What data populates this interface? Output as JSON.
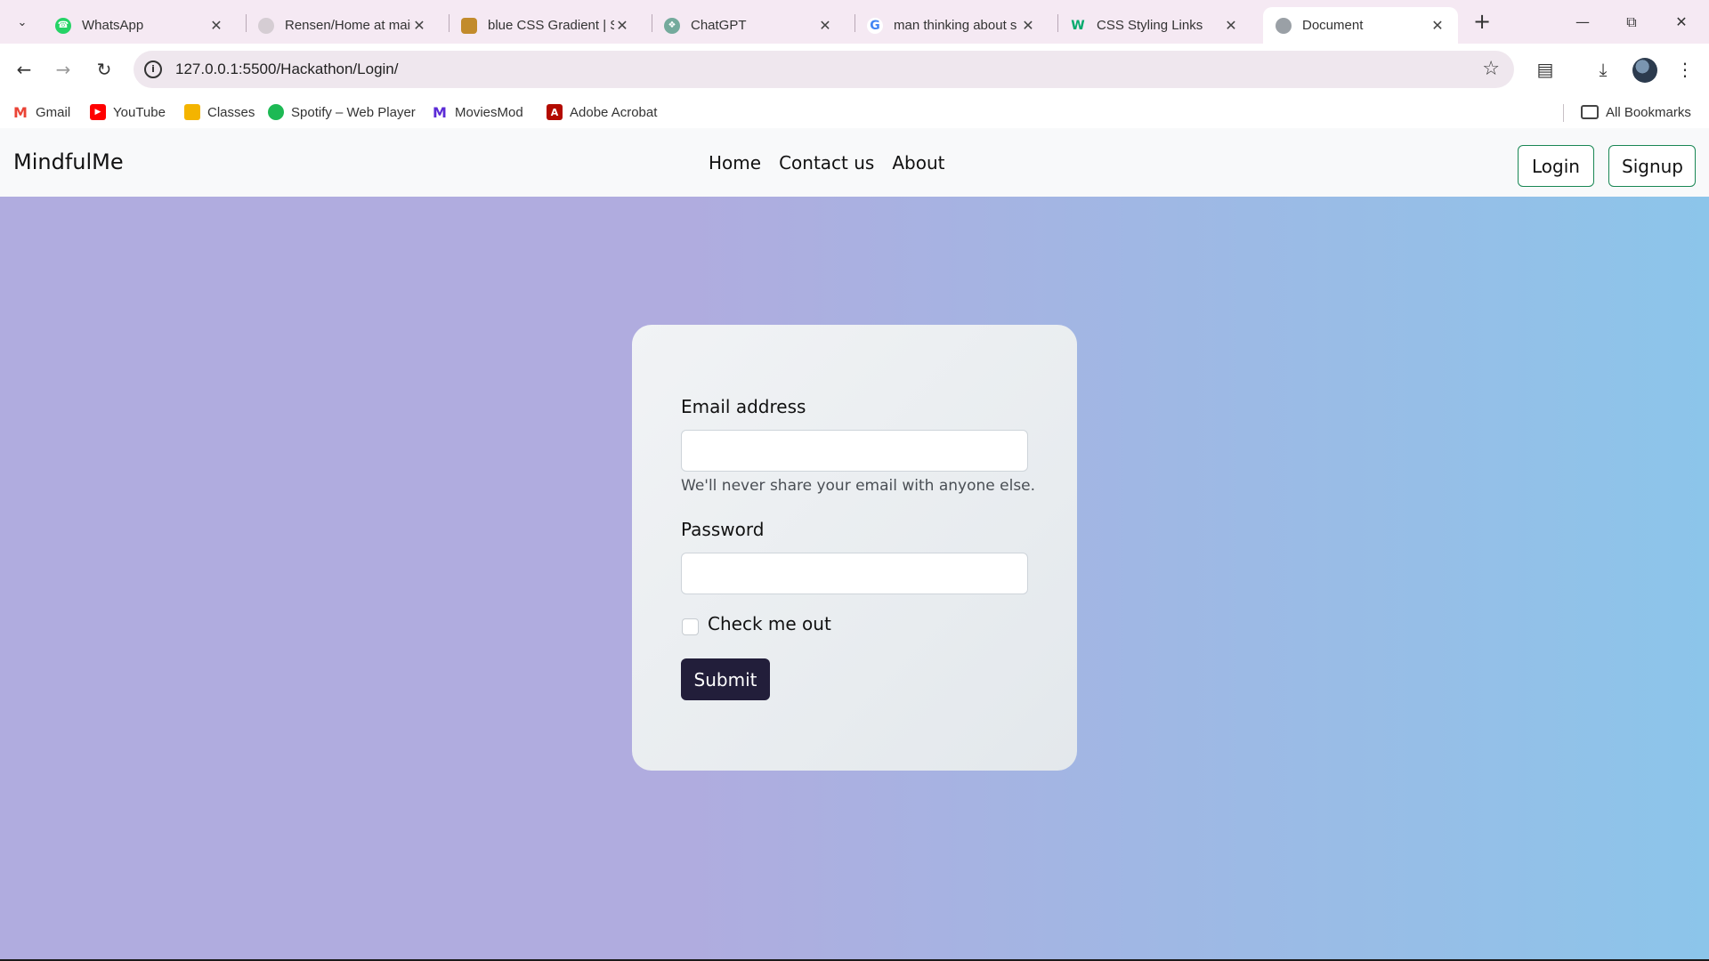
{
  "browser": {
    "tabs": [
      {
        "label": "WhatsApp",
        "icon": "whatsapp-icon",
        "color": "#25d366"
      },
      {
        "label": "Rensen/Home at main",
        "icon": "github-icon",
        "color": "#d5cdd3"
      },
      {
        "label": "blue CSS Gradient | S",
        "icon": "cssgradient-icon",
        "color": "#c28b2c"
      },
      {
        "label": "ChatGPT",
        "icon": "chatgpt-icon",
        "color": "#74aa9c"
      },
      {
        "label": "man thinking about s",
        "icon": "google-icon",
        "color": "#4285f4"
      },
      {
        "label": "CSS Styling Links",
        "icon": "w3schools-icon",
        "color": "#04aa6d"
      },
      {
        "label": "Document",
        "icon": "globe-icon",
        "color": "#9aa0a6",
        "active": true
      }
    ],
    "url": "127.0.0.1:5500/Hackathon/Login/",
    "bookmarks": [
      {
        "label": "Gmail",
        "icon": "gmail-icon",
        "color": "#ea4335"
      },
      {
        "label": "YouTube",
        "icon": "youtube-icon",
        "color": "#ff0000"
      },
      {
        "label": "Classes",
        "icon": "classroom-icon",
        "color": "#f4b400"
      },
      {
        "label": "Spotify – Web Player",
        "icon": "spotify-icon",
        "color": "#1db954"
      },
      {
        "label": "MoviesMod",
        "icon": "moviesmod-icon",
        "color": "#5b2bd6"
      },
      {
        "label": "Adobe Acrobat",
        "icon": "acrobat-icon",
        "color": "#b30b00"
      }
    ],
    "all_bookmarks": "All Bookmarks"
  },
  "site": {
    "brand": "MindfulMe",
    "nav": {
      "home": "Home",
      "contact": "Contact us",
      "about": "About"
    },
    "login_label": "Login",
    "signup_label": "Signup"
  },
  "form": {
    "email_label": "Email address",
    "email_value": "",
    "email_help": "We'll never share your email with anyone else.",
    "password_label": "Password",
    "password_value": "",
    "check_label": "Check me out",
    "submit_label": "Submit"
  }
}
